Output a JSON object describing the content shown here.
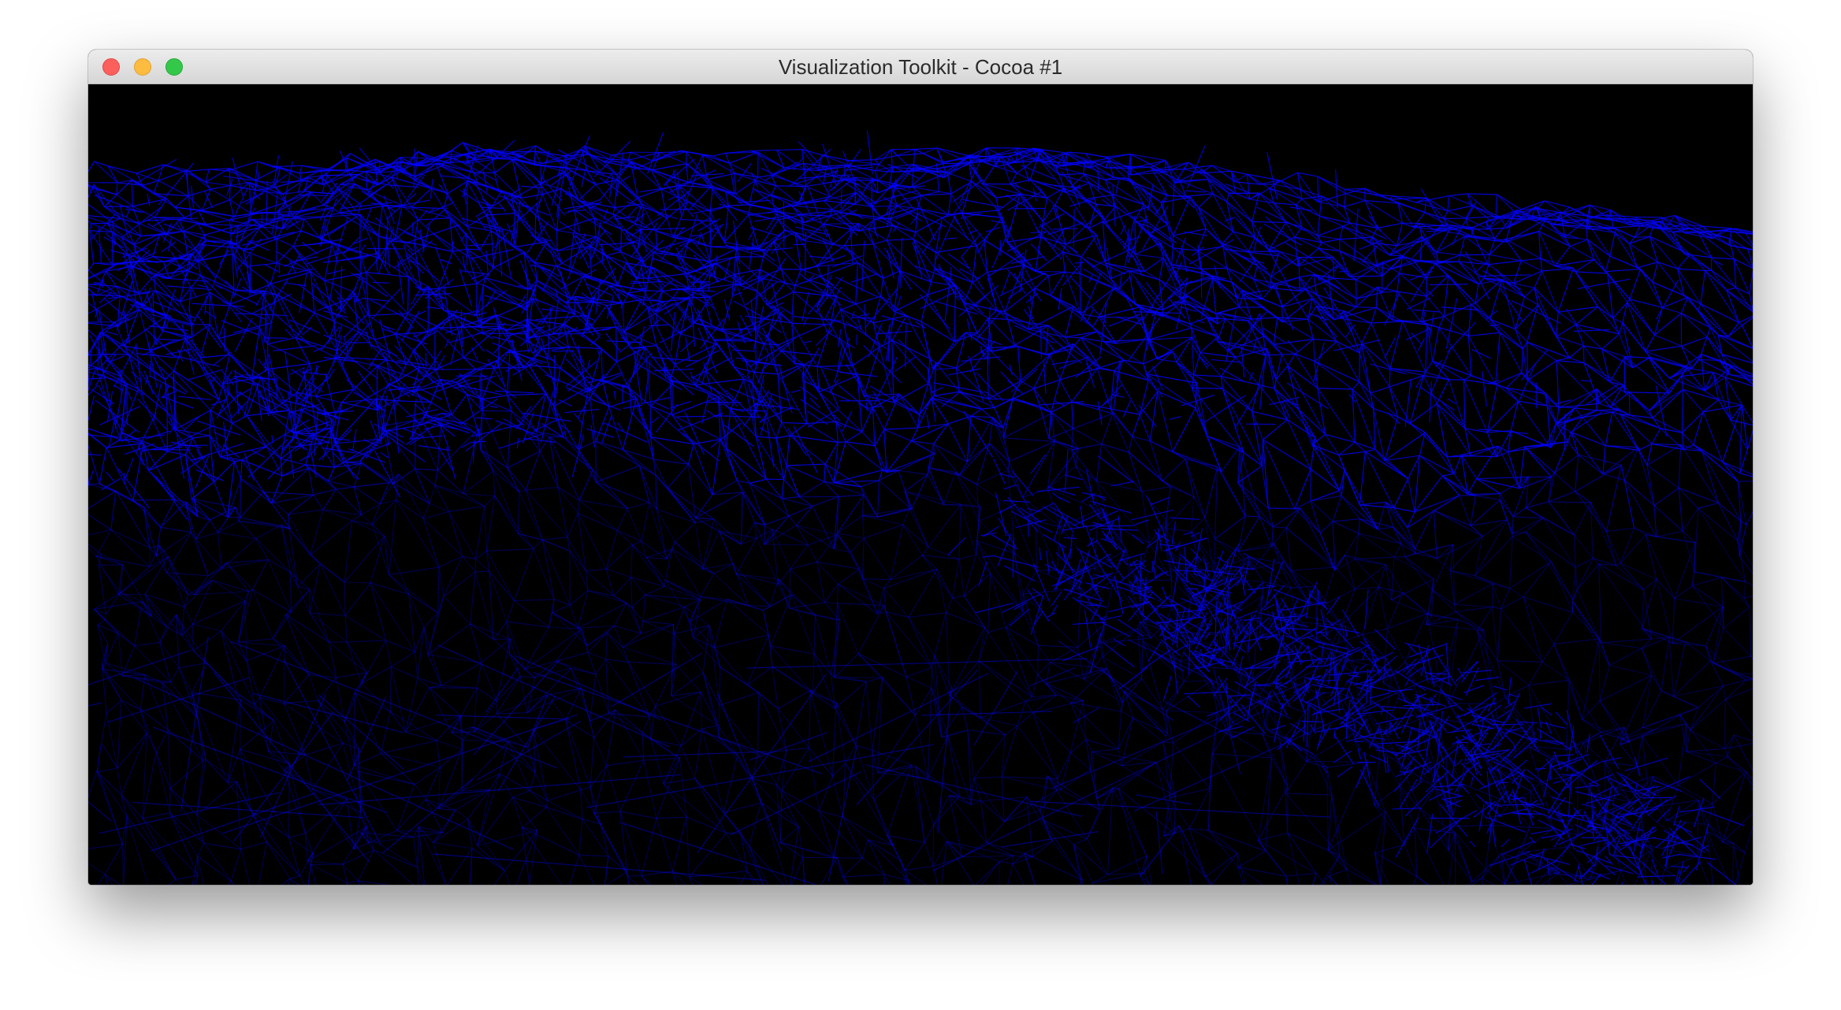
{
  "window": {
    "title": "Visualization Toolkit - Cocoa #1"
  },
  "titlebar": {
    "buttons": [
      "close",
      "minimize",
      "zoom"
    ],
    "colors": {
      "close": "#fc605c",
      "minimize": "#fdbc40",
      "zoom": "#34c84a"
    }
  },
  "render": {
    "background": "#000000",
    "mesh_color": "#0000ff",
    "representation": "wireframe"
  }
}
